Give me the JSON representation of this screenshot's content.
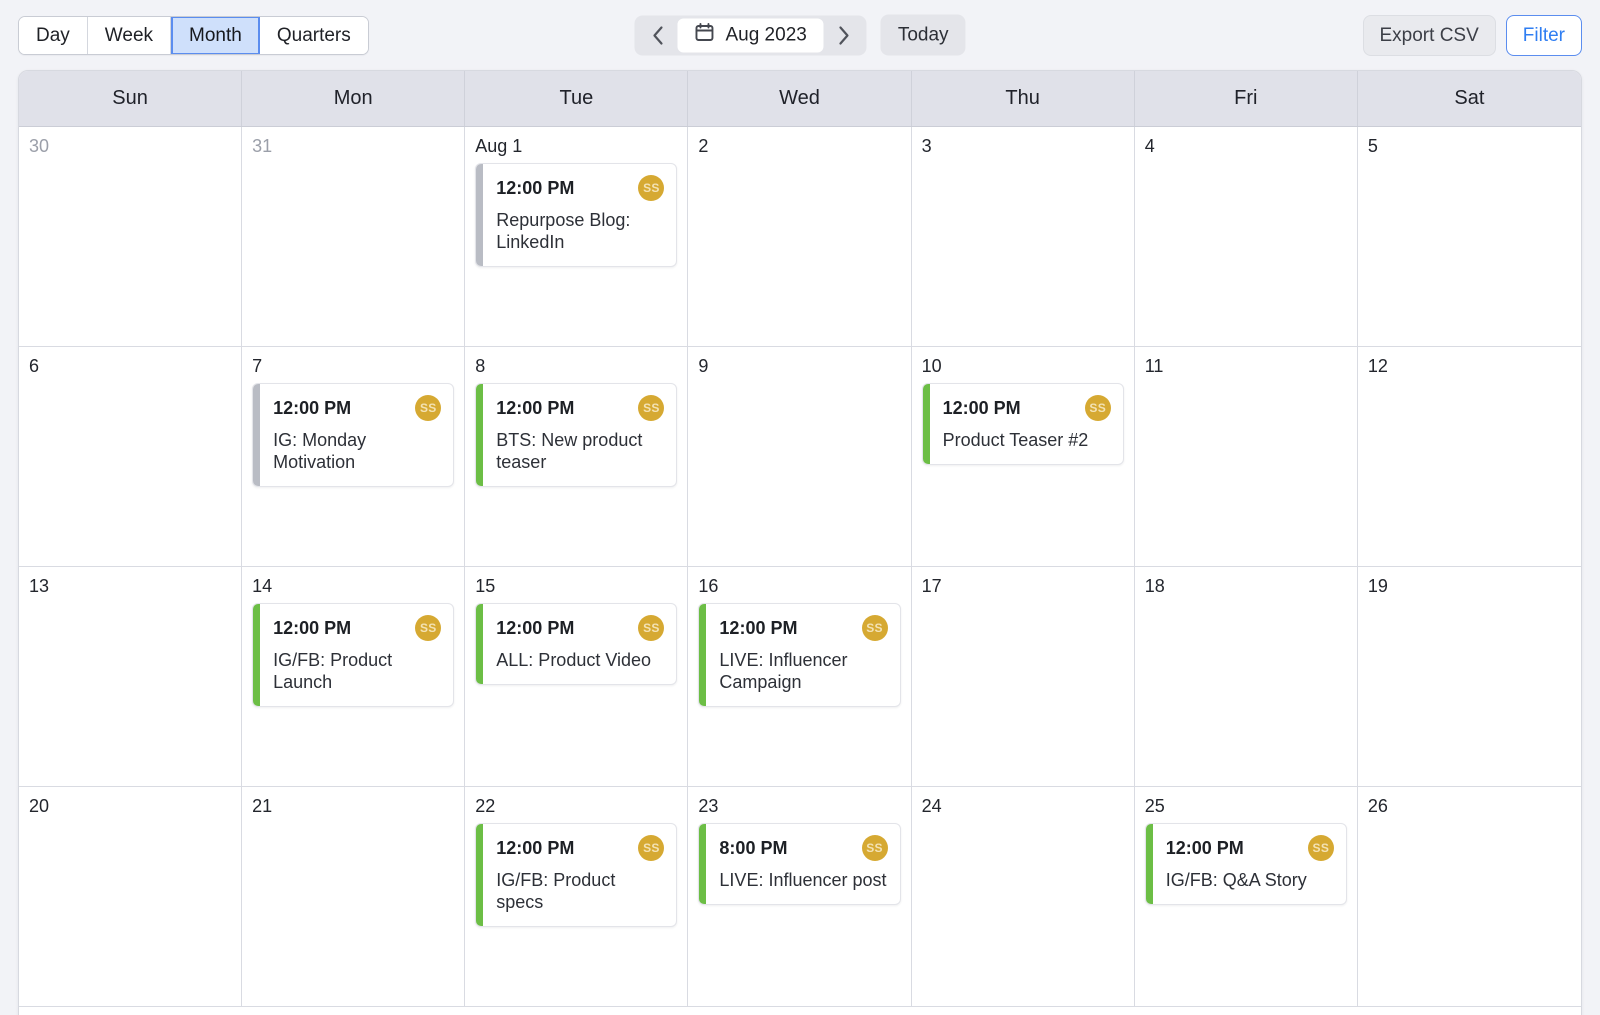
{
  "toolbar": {
    "views": [
      {
        "label": "Day",
        "active": false
      },
      {
        "label": "Week",
        "active": false
      },
      {
        "label": "Month",
        "active": true
      },
      {
        "label": "Quarters",
        "active": false
      }
    ],
    "prev_icon": "chevron-left-icon",
    "next_icon": "chevron-right-icon",
    "calendar_icon": "calendar-icon",
    "current_period": "Aug 2023",
    "today_label": "Today",
    "export_label": "Export CSV",
    "filter_label": "Filter"
  },
  "colors": {
    "page_bg": "#f2f3f7",
    "header_bg": "#e0e1e9",
    "accent_green": "#6cbe45",
    "accent_gray": "#b9bcc4",
    "avatar_gold": "#d6a932",
    "active_tab_bg": "#cfe0fb",
    "active_tab_border": "#5b8def",
    "filter_blue": "#2f7ef2"
  },
  "calendar": {
    "weekdays": [
      "Sun",
      "Mon",
      "Tue",
      "Wed",
      "Thu",
      "Fri",
      "Sat"
    ],
    "weeks": [
      [
        {
          "daynum": "30",
          "muted": true,
          "events": []
        },
        {
          "daynum": "31",
          "muted": true,
          "events": []
        },
        {
          "daynum": "Aug 1",
          "muted": false,
          "events": [
            {
              "time": "12:00 PM",
              "title": "Repurpose Blog: LinkedIn",
              "accent": "gray",
              "avatar": "SS"
            }
          ]
        },
        {
          "daynum": "2",
          "muted": false,
          "events": []
        },
        {
          "daynum": "3",
          "muted": false,
          "events": []
        },
        {
          "daynum": "4",
          "muted": false,
          "events": []
        },
        {
          "daynum": "5",
          "muted": false,
          "events": []
        }
      ],
      [
        {
          "daynum": "6",
          "muted": false,
          "events": []
        },
        {
          "daynum": "7",
          "muted": false,
          "events": [
            {
              "time": "12:00 PM",
              "title": "IG: Monday Motivation",
              "accent": "gray",
              "avatar": "SS"
            }
          ]
        },
        {
          "daynum": "8",
          "muted": false,
          "events": [
            {
              "time": "12:00 PM",
              "title": "BTS: New product teaser",
              "accent": "green",
              "avatar": "SS"
            }
          ]
        },
        {
          "daynum": "9",
          "muted": false,
          "events": []
        },
        {
          "daynum": "10",
          "muted": false,
          "events": [
            {
              "time": "12:00 PM",
              "title": "Product Teaser #2",
              "accent": "green",
              "avatar": "SS"
            }
          ]
        },
        {
          "daynum": "11",
          "muted": false,
          "events": []
        },
        {
          "daynum": "12",
          "muted": false,
          "events": []
        }
      ],
      [
        {
          "daynum": "13",
          "muted": false,
          "events": []
        },
        {
          "daynum": "14",
          "muted": false,
          "events": [
            {
              "time": "12:00 PM",
              "title": "IG/FB: Product Launch",
              "accent": "green",
              "avatar": "SS"
            }
          ]
        },
        {
          "daynum": "15",
          "muted": false,
          "events": [
            {
              "time": "12:00 PM",
              "title": "ALL: Product Video",
              "accent": "green",
              "avatar": "SS"
            }
          ]
        },
        {
          "daynum": "16",
          "muted": false,
          "events": [
            {
              "time": "12:00 PM",
              "title": "LIVE: Influencer Campaign",
              "accent": "green",
              "avatar": "SS"
            }
          ]
        },
        {
          "daynum": "17",
          "muted": false,
          "events": []
        },
        {
          "daynum": "18",
          "muted": false,
          "events": []
        },
        {
          "daynum": "19",
          "muted": false,
          "events": []
        }
      ],
      [
        {
          "daynum": "20",
          "muted": false,
          "events": []
        },
        {
          "daynum": "21",
          "muted": false,
          "events": []
        },
        {
          "daynum": "22",
          "muted": false,
          "events": [
            {
              "time": "12:00 PM",
              "title": "IG/FB: Product specs",
              "accent": "green",
              "avatar": "SS"
            }
          ]
        },
        {
          "daynum": "23",
          "muted": false,
          "events": [
            {
              "time": "8:00 PM",
              "title": "LIVE: Influencer post",
              "accent": "green",
              "avatar": "SS"
            }
          ]
        },
        {
          "daynum": "24",
          "muted": false,
          "events": []
        },
        {
          "daynum": "25",
          "muted": false,
          "events": [
            {
              "time": "12:00 PM",
              "title": "IG/FB: Q&A Story",
              "accent": "green",
              "avatar": "SS"
            }
          ]
        },
        {
          "daynum": "26",
          "muted": false,
          "events": []
        }
      ]
    ]
  }
}
